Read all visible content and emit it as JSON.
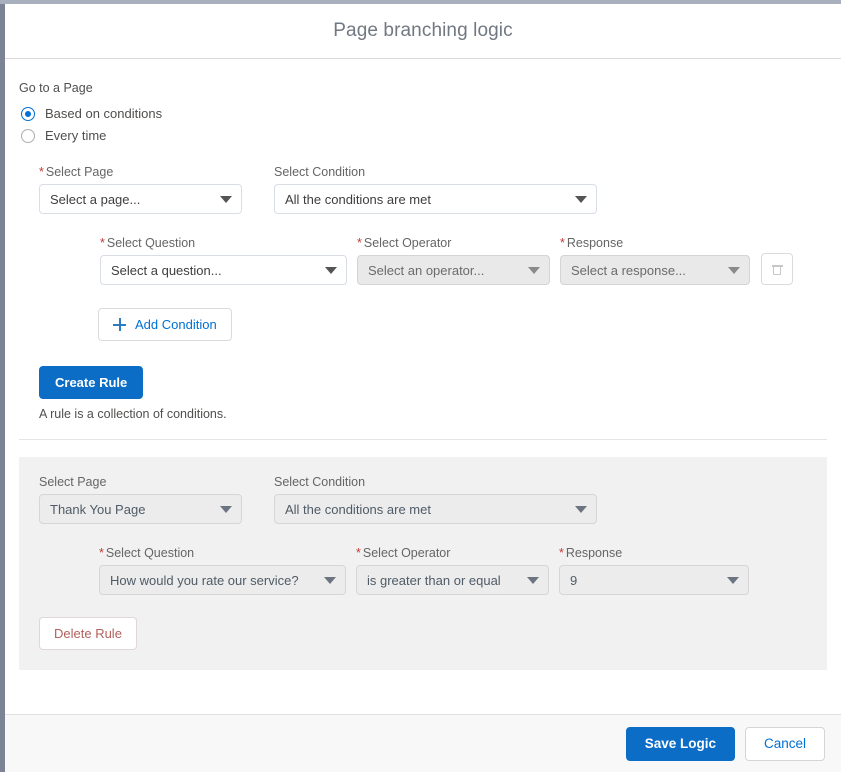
{
  "header": {
    "title": "Page branching logic"
  },
  "builder": {
    "section_label": "Go to a Page",
    "radios": [
      {
        "label": "Based on conditions",
        "selected": true
      },
      {
        "label": "Every time",
        "selected": false
      }
    ],
    "page_field": {
      "label": "Select Page",
      "required": true,
      "value": "Select a page..."
    },
    "condition_field": {
      "label": "Select Condition",
      "required": false,
      "value": "All the conditions are met"
    },
    "question_field": {
      "label": "Select Question",
      "required": true,
      "value": "Select a question..."
    },
    "operator_field": {
      "label": "Select Operator",
      "required": true,
      "value": "Select an operator..."
    },
    "response_field": {
      "label": "Response",
      "required": true,
      "value": "Select a response..."
    },
    "delete_condition_icon": "trash-icon",
    "add_condition_label": "Add Condition",
    "create_rule_label": "Create Rule",
    "hint": "A rule is a collection of conditions."
  },
  "saved_rule": {
    "page_field": {
      "label": "Select Page",
      "required": false,
      "value": "Thank You Page"
    },
    "condition_field": {
      "label": "Select Condition",
      "required": false,
      "value": "All the conditions are met"
    },
    "question_field": {
      "label": "Select Question",
      "required": true,
      "value": "How would you rate our service?"
    },
    "operator_field": {
      "label": "Select Operator",
      "required": true,
      "value": "is greater than or equal"
    },
    "response_field": {
      "label": "Response",
      "required": true,
      "value": "9"
    },
    "delete_rule_label": "Delete Rule"
  },
  "footer": {
    "save_label": "Save Logic",
    "cancel_label": "Cancel"
  },
  "colors": {
    "accent_blue": "#0c6dc7",
    "link_blue": "#0070d2",
    "required_red": "#c23934",
    "delete_red": "#b4605c",
    "panel_grey": "#f1f1f1",
    "disabled_grey": "#e9e9e9"
  }
}
